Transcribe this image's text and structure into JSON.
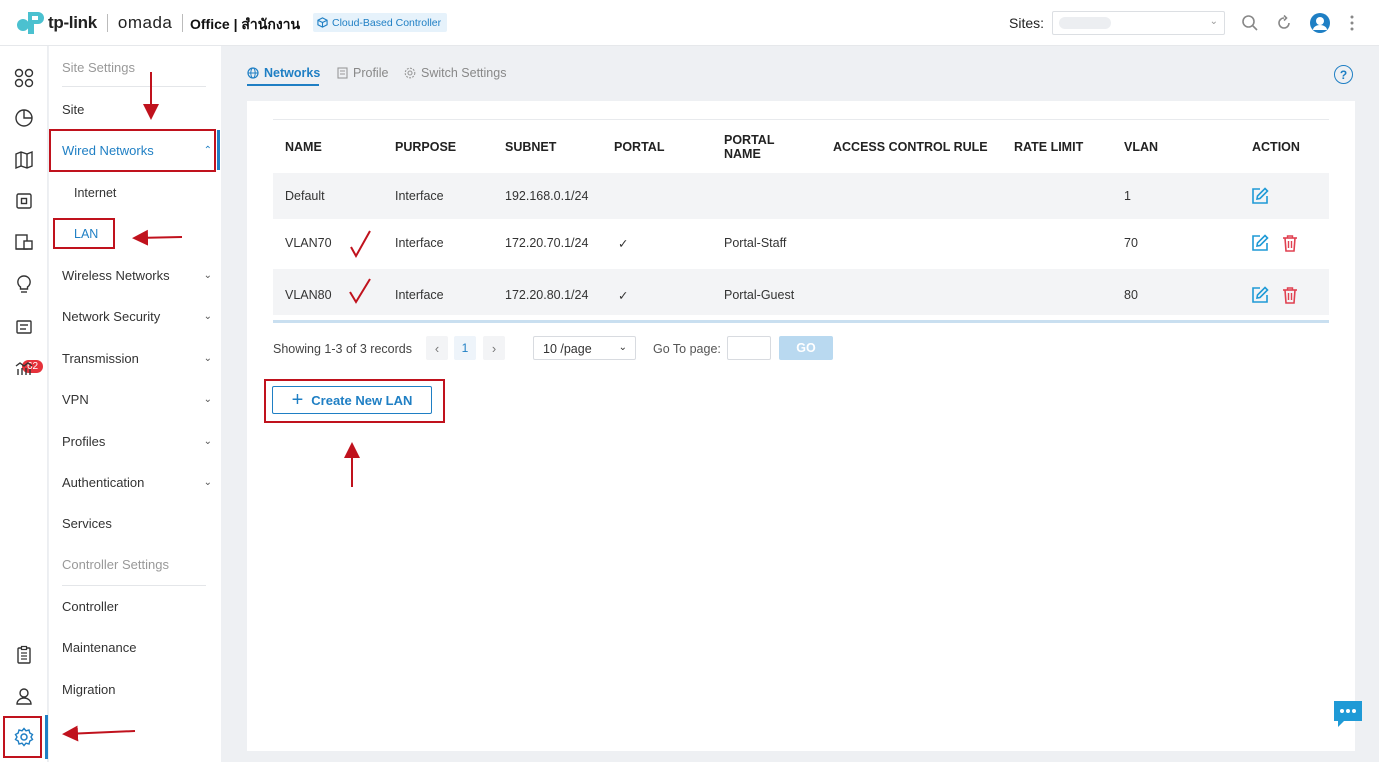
{
  "header": {
    "logo_text": "tp-link",
    "product": "omada",
    "site_title": "Office | สำนักงาน",
    "badge": "Cloud-Based Controller",
    "sites_label": "Sites:",
    "icons": [
      "search-icon",
      "refresh-icon",
      "user-avatar-icon",
      "more-vertical-icon"
    ]
  },
  "rail": {
    "icons": [
      "dashboard-icon",
      "statistics-icon",
      "map-icon",
      "devices-icon",
      "clients-icon",
      "insight-icon",
      "log-icon",
      "report-icon",
      "audit-log-icon",
      "account-icon",
      "settings-icon"
    ],
    "log_badge": "62"
  },
  "menu": {
    "site_settings_label": "Site Settings",
    "site": "Site",
    "wired_networks": "Wired Networks",
    "internet": "Internet",
    "lan": "LAN",
    "wireless_networks": "Wireless Networks",
    "network_security": "Network Security",
    "transmission": "Transmission",
    "vpn": "VPN",
    "profiles": "Profiles",
    "authentication": "Authentication",
    "services": "Services",
    "controller_settings_label": "Controller Settings",
    "controller": "Controller",
    "maintenance": "Maintenance",
    "migration": "Migration"
  },
  "tabs": {
    "networks": "Networks",
    "profile": "Profile",
    "switch_settings": "Switch Settings"
  },
  "table": {
    "headers": {
      "name": "NAME",
      "purpose": "PURPOSE",
      "subnet": "SUBNET",
      "portal": "PORTAL",
      "portal_name_1": "PORTAL",
      "portal_name_2": "NAME",
      "acl": "ACCESS CONTROL RULE",
      "rate_limit": "RATE LIMIT",
      "vlan": "VLAN",
      "action": "ACTION"
    },
    "rows": [
      {
        "name": "Default",
        "purpose": "Interface",
        "subnet": "192.168.0.1/24",
        "portal": "",
        "portal_name": "",
        "acl": "",
        "rate_limit": "",
        "vlan": "1"
      },
      {
        "name": "VLAN70",
        "purpose": "Interface",
        "subnet": "172.20.70.1/24",
        "portal": "✓",
        "portal_name": "Portal-Staff",
        "acl": "",
        "rate_limit": "",
        "vlan": "70"
      },
      {
        "name": "VLAN80",
        "purpose": "Interface",
        "subnet": "172.20.80.1/24",
        "portal": "✓",
        "portal_name": "Portal-Guest",
        "acl": "",
        "rate_limit": "",
        "vlan": "80"
      }
    ]
  },
  "pagination": {
    "showing": "Showing 1-3 of 3 records",
    "current_page": "1",
    "per_page": "10 /page",
    "goto_label": "Go To page:",
    "goto_value": "",
    "go_button": "GO"
  },
  "actions": {
    "create_new_lan": "Create New LAN"
  },
  "colors": {
    "accent": "#1f7fc4",
    "annotation_red": "#c0121d",
    "badge_red": "#e6323b",
    "delete_red": "#e04050"
  }
}
